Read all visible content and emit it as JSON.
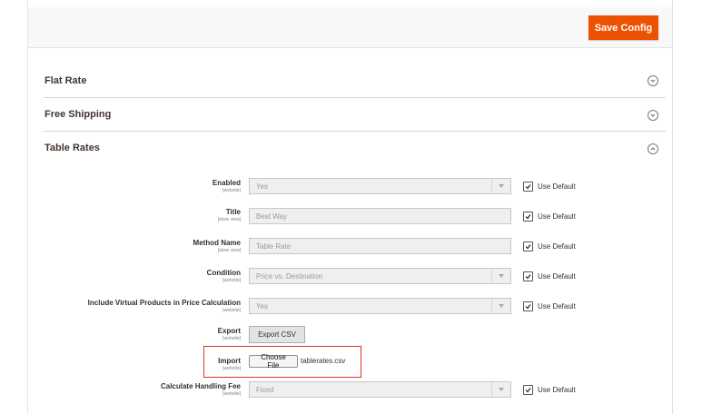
{
  "toolbar": {
    "save_label": "Save Config"
  },
  "sections": {
    "flat_rate": {
      "title": "Flat Rate"
    },
    "free_shipping": {
      "title": "Free Shipping"
    },
    "table_rates": {
      "title": "Table Rates"
    }
  },
  "icons": {
    "collapsed": "chevron-down-icon",
    "expanded": "chevron-up-icon",
    "checkbox": "checkmark-icon"
  },
  "colors": {
    "accent": "#eb5202",
    "highlight": "#d9322b"
  },
  "form": {
    "use_default_label": "Use Default",
    "enabled": {
      "label": "Enabled",
      "scope": "[website]",
      "value": "Yes",
      "use_default": true
    },
    "title": {
      "label": "Title",
      "scope": "[store view]",
      "value": "Best Way",
      "use_default": true
    },
    "method_name": {
      "label": "Method Name",
      "scope": "[store view]",
      "value": "Table Rate",
      "use_default": true
    },
    "condition": {
      "label": "Condition",
      "scope": "[website]",
      "value": "Price vs. Destination",
      "use_default": true
    },
    "include_virtual": {
      "label": "Include Virtual Products in Price Calculation",
      "scope": "[website]",
      "value": "Yes",
      "use_default": true
    },
    "export": {
      "label": "Export",
      "scope": "[website]",
      "button": "Export CSV"
    },
    "import": {
      "label": "Import",
      "scope": "[website]",
      "button": "Choose File",
      "file": "tablerates.csv"
    },
    "handling_fee": {
      "label": "Calculate Handling Fee",
      "scope": "[website]",
      "value": "Fixed",
      "use_default": true
    }
  }
}
